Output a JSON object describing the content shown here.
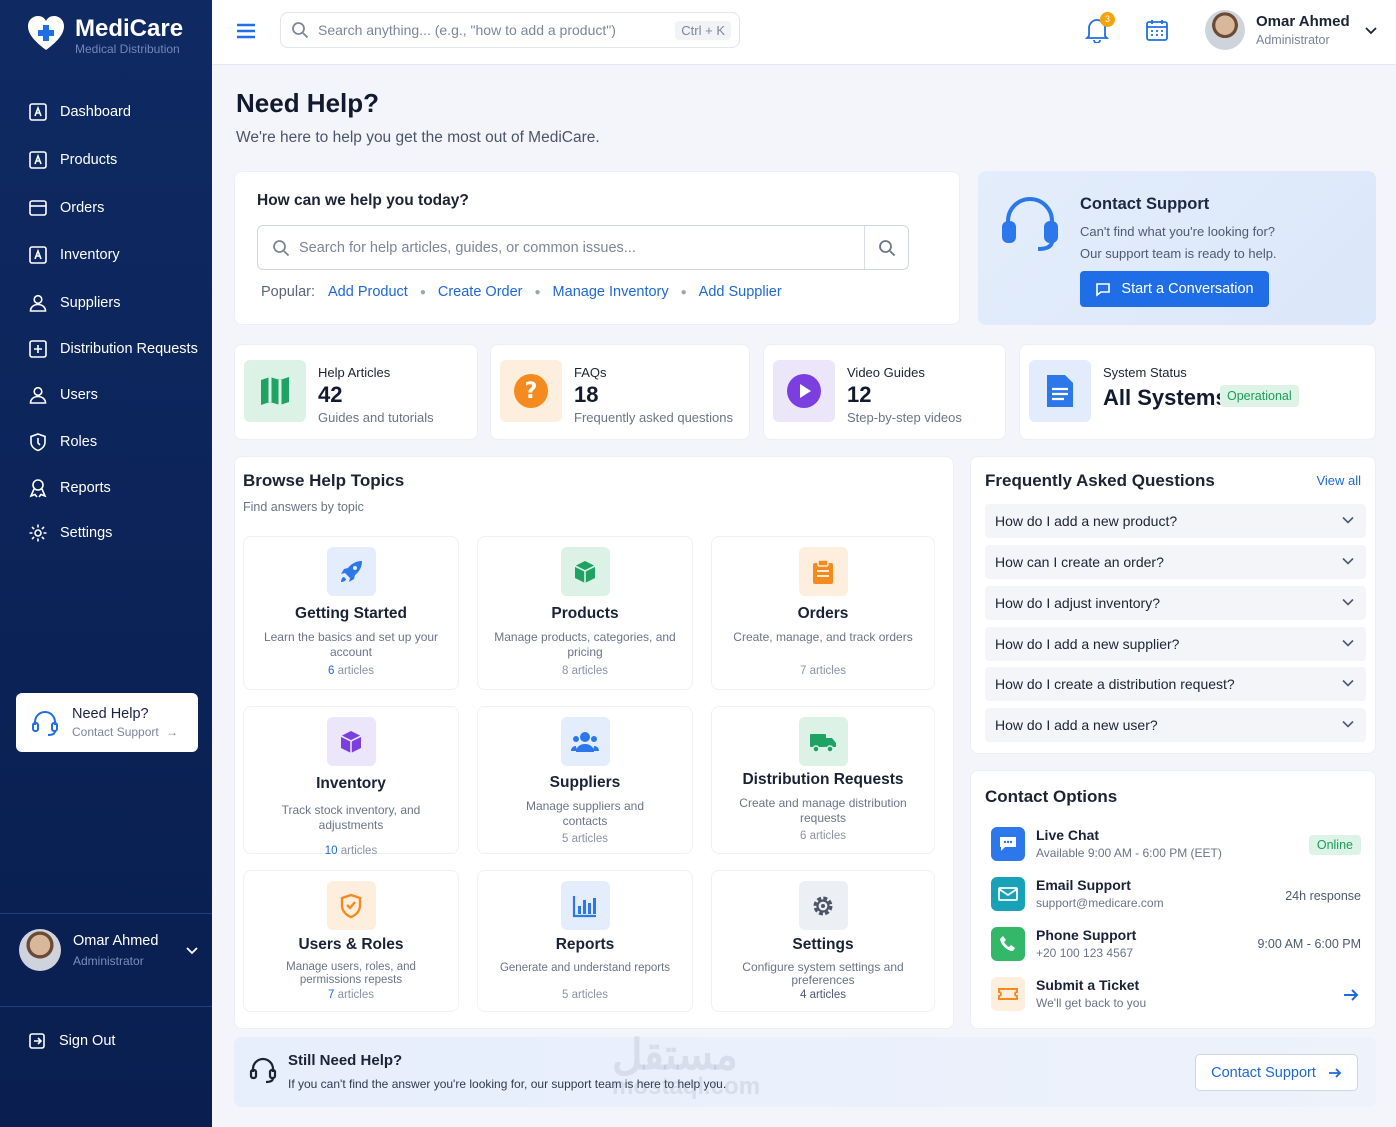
{
  "brand": {
    "name": "MediCare",
    "subtitle": "Medical Distribution"
  },
  "sidebar": {
    "items": [
      {
        "label": "Dashboard",
        "icon": "dashboard-icon"
      },
      {
        "label": "Products",
        "icon": "products-icon"
      },
      {
        "label": "Orders",
        "icon": "orders-icon"
      },
      {
        "label": "Inventory",
        "icon": "inventory-icon"
      },
      {
        "label": "Suppliers",
        "icon": "suppliers-icon"
      },
      {
        "label": "Distribution Requests",
        "icon": "distribution-icon"
      },
      {
        "label": "Users",
        "icon": "users-icon"
      },
      {
        "label": "Roles",
        "icon": "roles-icon"
      },
      {
        "label": "Reports",
        "icon": "reports-icon"
      },
      {
        "label": "Settings",
        "icon": "settings-icon"
      }
    ],
    "help": {
      "title": "Need Help?",
      "link": "Contact Support"
    },
    "user": {
      "name": "Omar Ahmed",
      "role": "Administrator"
    },
    "signout": "Sign Out"
  },
  "topbar": {
    "search_placeholder": "Search anything... (e.g., \"how to add a product\")",
    "shortcut": "Ctrl + K",
    "notifications": "3",
    "user": {
      "name": "Omar Ahmed",
      "role": "Administrator"
    }
  },
  "page": {
    "title": "Need Help?",
    "subtitle": "We're here to help you get the most out of MediCare."
  },
  "help_search": {
    "title": "How can we help you today?",
    "placeholder": "Search for help articles, guides, or common issues...",
    "popular_label": "Popular:",
    "popular": [
      "Add Product",
      "Create Order",
      "Manage Inventory",
      "Add Supplier"
    ]
  },
  "contact_card": {
    "title": "Contact Support",
    "line1": "Can't find what you're looking for?",
    "line2": "Our support team is ready to help.",
    "button": "Start a Conversation"
  },
  "stats": [
    {
      "label": "Help Articles",
      "value": "42",
      "sub": "Guides and tutorials"
    },
    {
      "label": "FAQs",
      "value": "18",
      "sub": "Frequently asked questions"
    },
    {
      "label": "Video Guides",
      "value": "12",
      "sub": "Step-by-step videos"
    },
    {
      "label": "System Status",
      "value": "All Systems",
      "badge": "Operational"
    }
  ],
  "topics": {
    "title": "Browse Help Topics",
    "subtitle": "Find answers by topic",
    "items": [
      {
        "title": "Getting Started",
        "desc": "Learn the basics and set up your account",
        "count": "6",
        "unit": "articles"
      },
      {
        "title": "Products",
        "desc": "Manage products, categories, and pricing",
        "count": "8",
        "unit": "articles"
      },
      {
        "title": "Orders",
        "desc": "Create, manage, and track orders",
        "count": "7",
        "unit": "articles"
      },
      {
        "title": "Inventory",
        "desc": "Track stock inventory, and adjustments",
        "count": "10",
        "unit": "articles"
      },
      {
        "title": "Suppliers",
        "desc": "Manage suppliers and contacts",
        "count": "5",
        "unit": "articles"
      },
      {
        "title": "Distribution Requests",
        "desc": "Create and manage distribution requests",
        "count": "6",
        "unit": "articles"
      },
      {
        "title": "Users & Roles",
        "desc": "Manage users, roles, and permissions repests",
        "count": "7",
        "unit": "articles"
      },
      {
        "title": "Reports",
        "desc": "Generate and understand reports",
        "count": "5",
        "unit": "articles"
      },
      {
        "title": "Settings",
        "desc": "Configure system settings and preferences",
        "count": "4",
        "unit": "articles"
      }
    ]
  },
  "faq": {
    "title": "Frequently Asked Questions",
    "view_all": "View all",
    "items": [
      "How do I add a new product?",
      "How can I create an order?",
      "How do I adjust inventory?",
      "How do I add a new supplier?",
      "How do I create a distribution request?",
      "How do I add a new user?"
    ]
  },
  "contact_options": {
    "title": "Contact Options",
    "items": [
      {
        "name": "Live Chat",
        "detail": "Available 9:00 AM - 6:00 PM (EET)",
        "right": "Online"
      },
      {
        "name": "Email Support",
        "detail": "support@medicare.com",
        "right": "24h response"
      },
      {
        "name": "Phone Support",
        "detail": "+20 100 123 4567",
        "right": "9:00 AM - 6:00 PM"
      },
      {
        "name": "Submit a Ticket",
        "detail": "We'll get back to you",
        "right": ""
      }
    ]
  },
  "still": {
    "title": "Still Need Help?",
    "desc": "If you can't find the answer you're looking for, our support team is here to help you.",
    "button": "Contact Support"
  },
  "watermark": {
    "arabic": "مستقل",
    "latin": "mostaql.com"
  },
  "colors": {
    "sidebar": "#0f2a63",
    "accent": "#1f6ee8",
    "link": "#1e68d9",
    "success": "#1a9e5c"
  }
}
